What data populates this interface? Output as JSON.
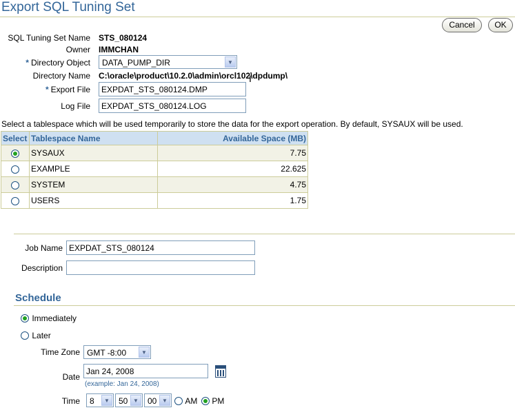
{
  "header": {
    "title": "Export SQL Tuning Set",
    "cancel_label": "Cancel",
    "ok_label": "OK"
  },
  "form": {
    "sts_name_label": "SQL Tuning Set Name",
    "sts_name_value": "STS_080124",
    "owner_label": "Owner",
    "owner_value": "IMMCHAN",
    "required_marker": "*",
    "directory_object_label": "Directory Object",
    "directory_object_value": "DATA_PUMP_DIR",
    "directory_name_label": "Directory Name",
    "directory_name_value": "C:\\oracle\\product\\10.2.0\\admin\\orcl102\\dpdump\\",
    "export_file_label": "Export File",
    "export_file_value": "EXPDAT_STS_080124.DMP",
    "log_file_label": "Log File",
    "log_file_value": "EXPDAT_STS_080124.LOG"
  },
  "tablespace": {
    "instruction": "Select a tablespace which will be used temporarily to store the data for the export operation. By default, SYSAUX will be used.",
    "columns": [
      "Select",
      "Tablespace Name",
      "Available Space (MB)"
    ],
    "rows": [
      {
        "name": "SYSAUX",
        "space": "7.75",
        "selected": true
      },
      {
        "name": "EXAMPLE",
        "space": "22.625",
        "selected": false
      },
      {
        "name": "SYSTEM",
        "space": "4.75",
        "selected": false
      },
      {
        "name": "USERS",
        "space": "1.75",
        "selected": false
      }
    ]
  },
  "job": {
    "job_name_label": "Job Name",
    "job_name_value": "EXPDAT_STS_080124",
    "description_label": "Description",
    "description_value": ""
  },
  "schedule": {
    "title": "Schedule",
    "immediately_label": "Immediately",
    "immediately_selected": true,
    "later_label": "Later",
    "later_selected": false,
    "time_zone_label": "Time Zone",
    "time_zone_value": "GMT -8:00",
    "date_label": "Date",
    "date_value": "Jan 24, 2008",
    "date_hint": "(example: Jan 24, 2008)",
    "time_label": "Time",
    "hour_value": "8",
    "minute_value": "50",
    "second_value": "00",
    "am_label": "AM",
    "pm_label": "PM",
    "pm_selected": true
  },
  "colors": {
    "accent": "#336699",
    "header_bg": "#cfe0f1",
    "border": "#cccc99",
    "radio_fill": "#21a121"
  },
  "icons": {
    "dropdown": "chevron-down-icon",
    "calendar": "calendar-icon"
  }
}
